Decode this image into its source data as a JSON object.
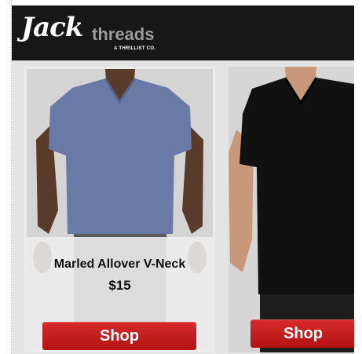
{
  "brand": {
    "logo_script": "Jack",
    "logo_word": "threads",
    "tagline": "A THRILLIST CO."
  },
  "products": [
    {
      "title": "Marled Allover V-Neck",
      "price": "$15",
      "shop_label": "Shop",
      "shirt_color": "#6a7aa6"
    },
    {
      "shop_label": "Shop",
      "shirt_color": "#111111"
    }
  ],
  "colors": {
    "header_bg": "#171717",
    "button_red": "#c41e1e",
    "logo_grey": "#9c9c9c"
  }
}
